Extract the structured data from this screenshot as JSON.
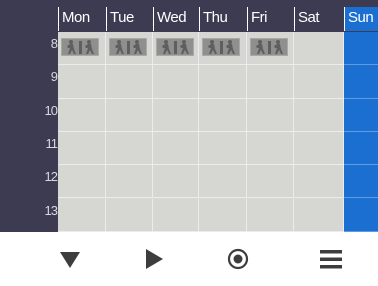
{
  "calendar": {
    "days": [
      {
        "label": "Mon",
        "today": false
      },
      {
        "label": "Tue",
        "today": false
      },
      {
        "label": "Wed",
        "today": false
      },
      {
        "label": "Thu",
        "today": false
      },
      {
        "label": "Fri",
        "today": false
      },
      {
        "label": "Sat",
        "today": false
      },
      {
        "label": "Sun",
        "today": true
      }
    ],
    "hours": [
      "8",
      "9",
      "10",
      "11",
      "12",
      "13"
    ],
    "activity_slots": [
      {
        "day": "Mon",
        "hour": "8",
        "icon": "walking-icon"
      },
      {
        "day": "Tue",
        "hour": "8",
        "icon": "walking-icon"
      },
      {
        "day": "Wed",
        "hour": "8",
        "icon": "walking-icon"
      },
      {
        "day": "Thu",
        "hour": "8",
        "icon": "walking-icon"
      },
      {
        "day": "Fri",
        "hour": "8",
        "icon": "walking-icon"
      }
    ]
  },
  "toolbar": {
    "buttons": [
      {
        "icon": "triangle-down-icon"
      },
      {
        "icon": "play-icon"
      },
      {
        "icon": "record-icon"
      },
      {
        "icon": "menu-icon"
      }
    ]
  },
  "colors": {
    "header_bg": "#3c3b52",
    "today_accent": "#1a6fd0",
    "grid_bg": "#d6d6d3",
    "toolbar_icon": "#3d3d3d"
  }
}
